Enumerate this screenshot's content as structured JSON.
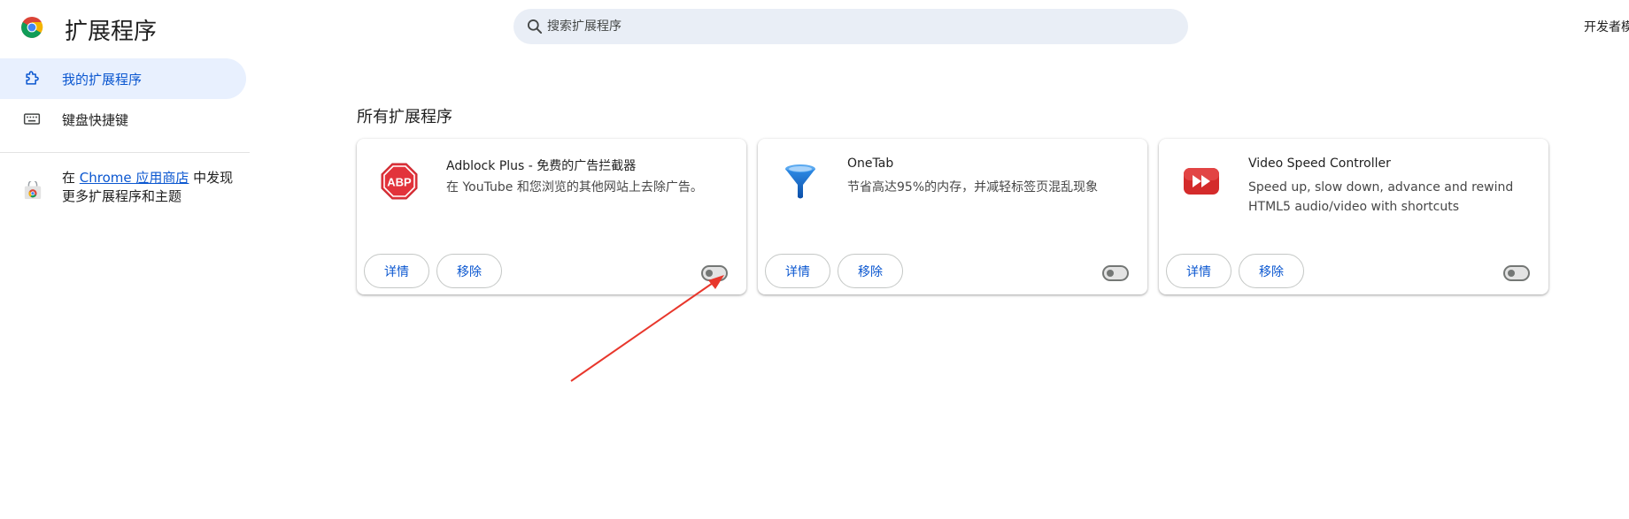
{
  "header": {
    "title": "扩展程序",
    "search_placeholder": "搜索扩展程序",
    "dev_mode_label": "开发者模"
  },
  "sidebar": {
    "items": [
      {
        "label": "我的扩展程序",
        "icon": "puzzle-icon",
        "active": true
      },
      {
        "label": "键盘快捷键",
        "icon": "keyboard-icon",
        "active": false
      }
    ],
    "store_promo": {
      "prefix": "在 ",
      "link": "Chrome 应用商店",
      "suffix": " 中发现更多扩展程序和主题"
    }
  },
  "main": {
    "section_title": "所有扩展程序",
    "extensions": [
      {
        "name": "Adblock Plus - 免费的广告拦截器",
        "description": "在 YouTube 和您浏览的其他网站上去除广告。",
        "icon": "abp-octagon-icon",
        "details_label": "详情",
        "remove_label": "移除",
        "enabled": false
      },
      {
        "name": "OneTab",
        "description": "节省高达95%的内存，并减轻标签页混乱现象",
        "icon": "onetab-funnel-icon",
        "details_label": "详情",
        "remove_label": "移除",
        "enabled": false
      },
      {
        "name": "Video Speed Controller",
        "description": "Speed up, slow down, advance and rewind HTML5 audio/video with shortcuts",
        "icon": "fast-forward-icon",
        "details_label": "详情",
        "remove_label": "移除",
        "enabled": false
      }
    ]
  },
  "colors": {
    "accent": "#0b57d0",
    "active_bg": "#e8f0fe",
    "search_bg": "#e9eef6",
    "annotation": "#e8372c"
  }
}
